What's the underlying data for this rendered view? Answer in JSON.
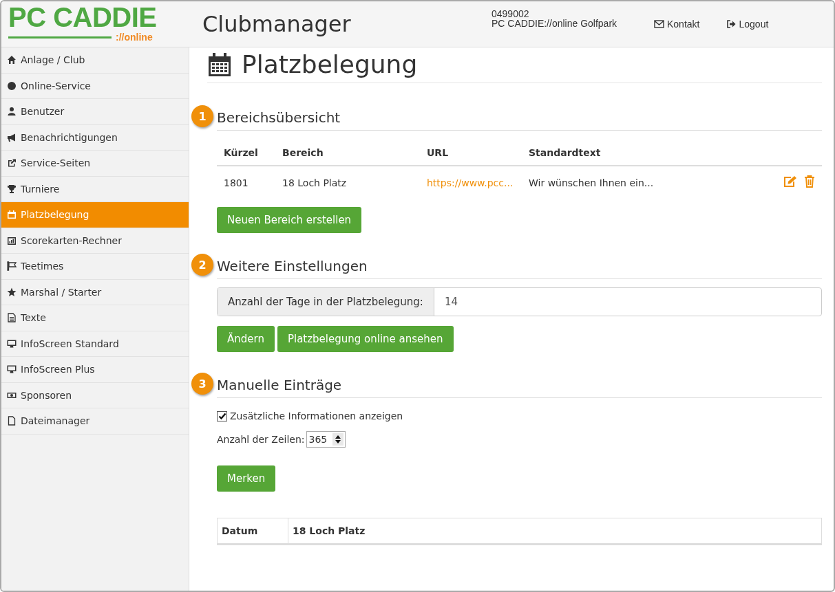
{
  "logo": {
    "title": "PC CADDIE",
    "subtitle": "://online"
  },
  "header": {
    "title": "Clubmanager",
    "club_number": "0499002",
    "club_name": "PC CADDIE://online Golfpark",
    "links": [
      {
        "label": "Kontakt"
      },
      {
        "label": "Logout"
      }
    ]
  },
  "sidebar": {
    "items": [
      {
        "label": "Anlage / Club",
        "selected": false
      },
      {
        "label": "Online-Service",
        "selected": false
      },
      {
        "label": "Benutzer",
        "selected": false
      },
      {
        "label": "Benachrichtigungen",
        "selected": false
      },
      {
        "label": "Service-Seiten",
        "selected": false
      },
      {
        "label": "Turniere",
        "selected": false
      },
      {
        "label": "Platzbelegung",
        "selected": true
      },
      {
        "label": "Scorekarten-Rechner",
        "selected": false
      },
      {
        "label": "Teetimes",
        "selected": false
      },
      {
        "label": "Marshal / Starter",
        "selected": false
      },
      {
        "label": "Texte",
        "selected": false
      },
      {
        "label": "InfoScreen Standard",
        "selected": false
      },
      {
        "label": "InfoScreen Plus",
        "selected": false
      },
      {
        "label": "Sponsoren",
        "selected": false
      },
      {
        "label": "Dateimanager",
        "selected": false
      }
    ]
  },
  "page_title": "Platzbelegung",
  "sections": [
    {
      "number": "1",
      "title": "Bereichsübersicht"
    },
    {
      "number": "2",
      "title": "Weitere Einstellungen"
    },
    {
      "number": "3",
      "title": "Manuelle Einträge"
    }
  ],
  "areas_table": {
    "columns": [
      "Kürzel",
      "Bereich",
      "URL",
      "Standardtext"
    ],
    "rows": [
      {
        "code": "1801",
        "area": "18 Loch Platz",
        "url": "https://www.pcc...",
        "text": "Wir wünschen Ihnen ein..."
      }
    ],
    "create_button": "Neuen Bereich erstellen"
  },
  "settings": {
    "label": "Anzahl der Tage in der Platzbelegung:",
    "value": "14",
    "buttons": [
      "Ändern",
      "Platzbelegung online ansehen"
    ]
  },
  "manual": {
    "checkbox": {
      "label": "Zusätzliche Informationen anzeigen",
      "checked": true
    },
    "rows_label": "Anzahl der Zeilen:",
    "rows_value": "365",
    "save_button": "Merken",
    "table_columns": [
      "Datum",
      "18 Loch Platz"
    ]
  }
}
